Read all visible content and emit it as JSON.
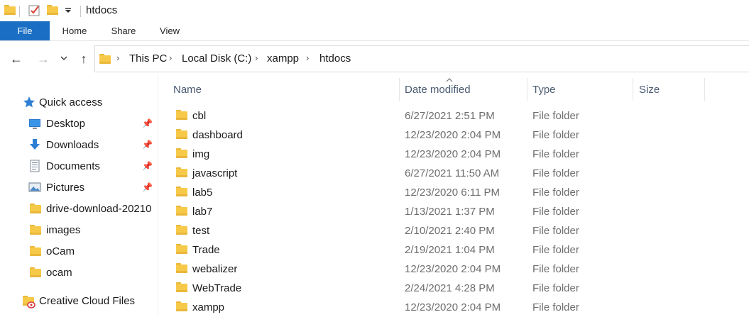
{
  "window": {
    "title": "htdocs"
  },
  "ribbon": {
    "tabs": [
      "File",
      "Home",
      "Share",
      "View"
    ]
  },
  "address": {
    "crumbs": [
      "This PC",
      "Local Disk (C:)",
      "xampp",
      "htdocs"
    ]
  },
  "sidebar": {
    "quick_access": "Quick access",
    "items": [
      {
        "label": "Desktop",
        "icon": "desktop-icon",
        "pinned": true
      },
      {
        "label": "Downloads",
        "icon": "download-arrow-icon",
        "pinned": true
      },
      {
        "label": "Documents",
        "icon": "documents-icon",
        "pinned": true
      },
      {
        "label": "Pictures",
        "icon": "pictures-icon",
        "pinned": true
      },
      {
        "label": "drive-download-20210",
        "icon": "folder-icon",
        "pinned": false
      },
      {
        "label": "images",
        "icon": "folder-icon",
        "pinned": false
      },
      {
        "label": "oCam",
        "icon": "folder-icon",
        "pinned": false
      },
      {
        "label": "ocam",
        "icon": "folder-icon",
        "pinned": false
      }
    ],
    "creative_cloud": "Creative Cloud Files"
  },
  "columns": {
    "name": "Name",
    "date": "Date modified",
    "type": "Type",
    "size": "Size"
  },
  "files": [
    {
      "name": "cbl",
      "date": "6/27/2021 2:51 PM",
      "type": "File folder"
    },
    {
      "name": "dashboard",
      "date": "12/23/2020 2:04 PM",
      "type": "File folder"
    },
    {
      "name": "img",
      "date": "12/23/2020 2:04 PM",
      "type": "File folder"
    },
    {
      "name": "javascript",
      "date": "6/27/2021 11:50 AM",
      "type": "File folder"
    },
    {
      "name": "lab5",
      "date": "12/23/2020 6:11 PM",
      "type": "File folder"
    },
    {
      "name": "lab7",
      "date": "1/13/2021 1:37 PM",
      "type": "File folder"
    },
    {
      "name": "test",
      "date": "2/10/2021 2:40 PM",
      "type": "File folder"
    },
    {
      "name": "Trade",
      "date": "2/19/2021 1:04 PM",
      "type": "File folder"
    },
    {
      "name": "webalizer",
      "date": "12/23/2020 2:04 PM",
      "type": "File folder"
    },
    {
      "name": "WebTrade",
      "date": "2/24/2021 4:28 PM",
      "type": "File folder"
    },
    {
      "name": "xampp",
      "date": "12/23/2020 2:04 PM",
      "type": "File folder"
    }
  ],
  "colors": {
    "file_tab": "#1a6fc4",
    "folder": "#f7c948",
    "quick_access_star": "#2d7fd3"
  }
}
